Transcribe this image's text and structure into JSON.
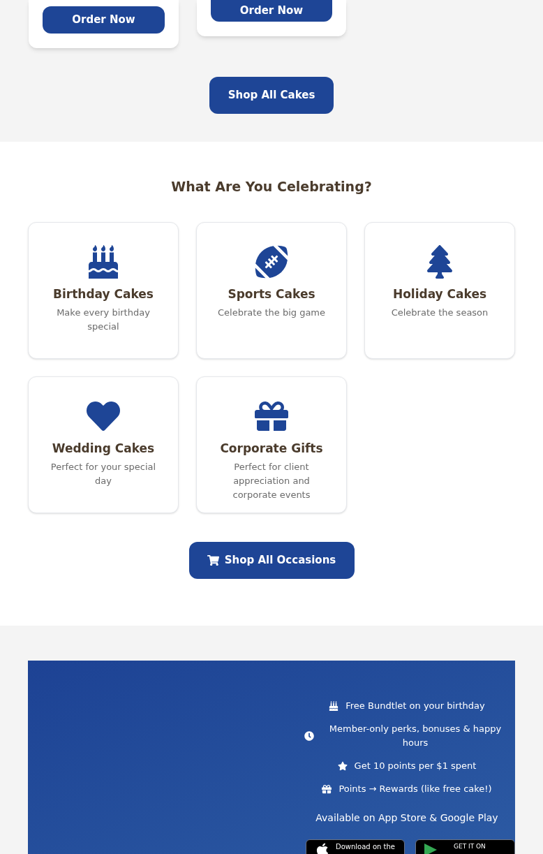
{
  "top_products": {
    "buttons": [
      "Order Now",
      "Order Now"
    ],
    "shop_button": "Shop All Cakes"
  },
  "occasions": {
    "title": "What Are You Celebrating?",
    "items": [
      {
        "kind": "birthday",
        "title": "Birthday Cakes",
        "description": "Make every birthday special"
      },
      {
        "kind": "sports",
        "title": "Sports Cakes",
        "description": "Celebrate the big game"
      },
      {
        "kind": "holiday",
        "title": "Holiday Cakes",
        "description": "Celebrate the season"
      },
      {
        "kind": "wedding",
        "title": "Wedding Cakes",
        "description": "Perfect for your special day"
      },
      {
        "kind": "corporate",
        "title": "Corporate Gifts",
        "description": "Perfect for client appreciation and corporate events"
      }
    ],
    "shop_button": "Shop All Occasions"
  },
  "rewards": {
    "perks": [
      {
        "kind": "cake",
        "text": "Free Bundtlet on your birthday"
      },
      {
        "kind": "clock",
        "text": "Member-only perks, bonuses & happy hours"
      },
      {
        "kind": "star",
        "text": "Get 10 points per $1 spent"
      },
      {
        "kind": "gift",
        "text": "Points → Rewards (like free cake!)"
      }
    ],
    "availability": "Available on App Store & Google Play",
    "badges": [
      {
        "kind": "apple",
        "text": "Download on the"
      },
      {
        "kind": "google",
        "text": "GET IT ON"
      }
    ]
  }
}
